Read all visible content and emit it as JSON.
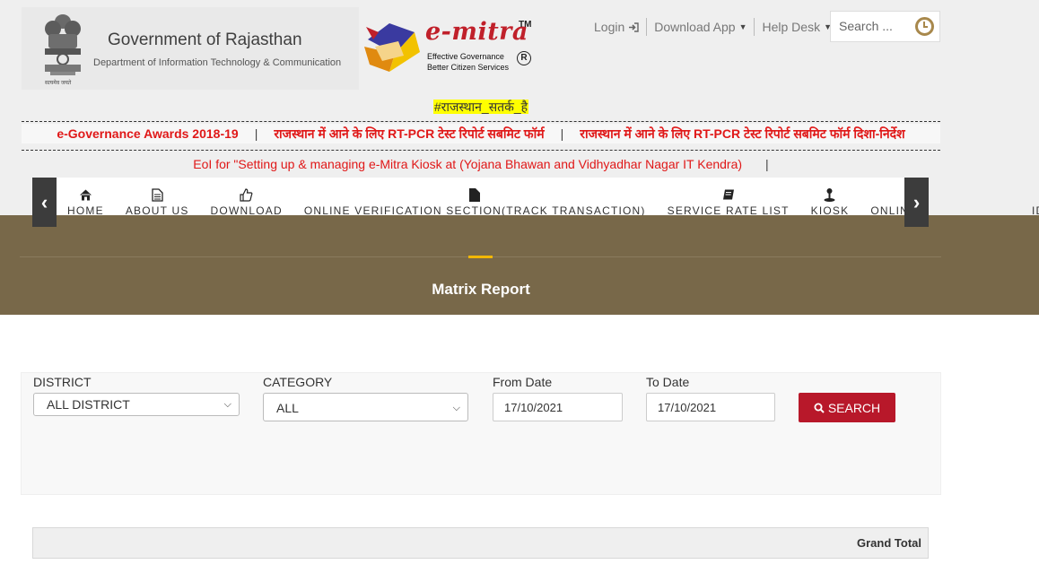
{
  "header": {
    "gov_title": "Government of Rajasthan",
    "gov_subtitle": "Department of Information Technology & Communication",
    "emblem_motto": "सत्यमेव जयते",
    "emitra_name": "e-mitra",
    "emitra_tm": "TM",
    "emitra_line1": "Effective Governance",
    "emitra_line2": "Better Citizen Services",
    "emitra_reg": "R",
    "links": {
      "login": "Login",
      "download_app": "Download App",
      "help_desk": "Help Desk"
    },
    "search_placeholder": "Search ..."
  },
  "ticker": {
    "hashtag": "#राजस्थान_सतर्क_है",
    "items_row1": [
      "e-Governance Awards 2018-19",
      "राजस्थान में आने के लिए RT-PCR टेस्ट रिपोर्ट सबमिट फॉर्म",
      "राजस्थान में आने के लिए RT-PCR टेस्ट रिपोर्ट सबमिट फॉर्म दिशा-निर्देश"
    ],
    "separator": "|",
    "row2": "EoI for \"Setting up & managing e-Mitra Kiosk at (Yojana Bhawan and Vidhyadhar Nagar IT Kendra)"
  },
  "nav": {
    "items": [
      {
        "label": "HOME",
        "icon": "home-icon"
      },
      {
        "label": "ABOUT US",
        "icon": "document-icon"
      },
      {
        "label": "DOWNLOAD",
        "icon": "thumbs-up-icon"
      },
      {
        "label": "ONLINE VERIFICATION SECTION(TRACK TRANSACTION)",
        "icon": "file-icon"
      },
      {
        "label": "SERVICE RATE LIST",
        "icon": "book-icon"
      },
      {
        "label": "KIOSK",
        "icon": "map-marker-icon"
      },
      {
        "label": "ONLINE VERIFICATION",
        "icon": "check-icon"
      }
    ],
    "stray_text": "ID"
  },
  "page": {
    "title": "Matrix Report"
  },
  "filters": {
    "district_label": "DISTRICT",
    "district_value": "ALL DISTRICT",
    "category_label": "CATEGORY",
    "category_value": "ALL",
    "from_date_label": "From Date",
    "from_date_value": "17/10/2021",
    "to_date_label": "To Date",
    "to_date_value": "17/10/2021",
    "search_button": "SEARCH"
  },
  "table": {
    "grand_total_label": "Grand Total"
  },
  "colors": {
    "banner": "#786849",
    "accent": "#f2b705",
    "button": "#b8182a",
    "ticker_text": "#e01818",
    "dark_arrow": "#3c3c3c"
  }
}
